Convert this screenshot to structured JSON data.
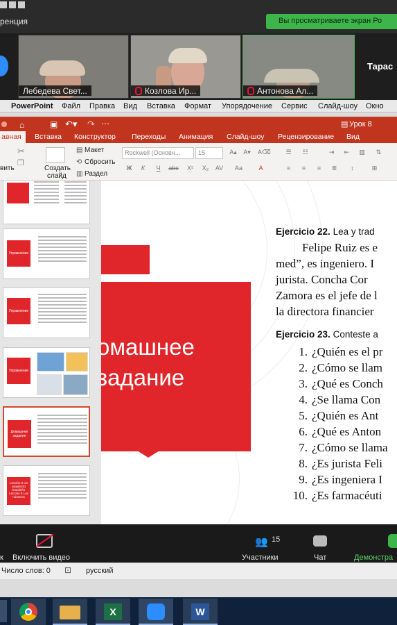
{
  "zoom": {
    "window_title": "ренция",
    "share_banner": "Вы просматриваете экран Ро",
    "participants": [
      {
        "name": "Лебедева Свет..."
      },
      {
        "name": "Козлова Ир..."
      },
      {
        "name": "Антонова Ал..."
      }
    ],
    "overflow_name": "Тарас",
    "bottom_bar": {
      "start_video": "Включить видео",
      "participants_label": "Участники",
      "participants_count": "15",
      "chat": "Чат",
      "share": "Демонстра",
      "left_partial": "к"
    }
  },
  "mac_menu": {
    "app": "PowerPoint",
    "items": [
      "Файл",
      "Правка",
      "Вид",
      "Вставка",
      "Формат",
      "Упорядочение",
      "Сервис",
      "Слайд-шоу",
      "Окно"
    ]
  },
  "ppt": {
    "doc_title": "Урок 8",
    "tabs": [
      "авная",
      "Вставка",
      "Конструктор",
      "Переходы",
      "Анимация",
      "Слайд-шоу",
      "Рецензирование",
      "Вид"
    ],
    "ribbon": {
      "create_slide_1": "Создать",
      "create_slide_2": "слайд",
      "vit": "вить",
      "layout": "Макет",
      "reset": "Сбросить",
      "section": "Раздел",
      "font_name": "Rockwell (Основн...",
      "font_size": "15"
    },
    "thumbs": [
      {
        "title": "",
        "selected": false
      },
      {
        "title": "Упражнение",
        "selected": false
      },
      {
        "title": "Упражнение",
        "selected": false
      },
      {
        "title": "Упражнение",
        "selected": false
      },
      {
        "title": "Домашнее задание",
        "selected": true
      },
      {
        "title": "Lección 6 Un arquitecto brasileño Lección 5 Los números",
        "selected": false
      }
    ],
    "slide": {
      "title_line1": "омашнее",
      "title_line2": "задание",
      "ex22_label": "Ejercicio 22.",
      "ex22_instr": "Lea y trad",
      "ex22_text": [
        "Felipe Ruiz es e",
        "med”, es ingeniero. I",
        "jurista. Concha Cor",
        "Zamora es el jefe de l",
        "la directora financier"
      ],
      "ex23_label": "Ejercicio 23.",
      "ex23_instr": "Conteste a",
      "questions": [
        {
          "n": "1.",
          "q": "¿Quién es el pr"
        },
        {
          "n": "2.",
          "q": "¿Cómo se llam"
        },
        {
          "n": "3.",
          "q": "¿Qué es Conch"
        },
        {
          "n": "4.",
          "q": "¿Se llama Con"
        },
        {
          "n": "5.",
          "q": "¿Quién es Ant"
        },
        {
          "n": "6.",
          "q": "¿Qué es Anton"
        },
        {
          "n": "7.",
          "q": "¿Cómo se llama"
        },
        {
          "n": "8.",
          "q": "¿Es jurista Feli"
        },
        {
          "n": "9.",
          "q": "¿Es ingeniera I"
        },
        {
          "n": "10.",
          "q": "¿Es farmacéuti"
        }
      ]
    }
  },
  "word_status": {
    "words": "Число слов: 0",
    "lang": "русский"
  },
  "colors": {
    "ppt_red": "#c1351f",
    "slide_red": "#e0262a",
    "zoom_green": "#3db54a"
  }
}
